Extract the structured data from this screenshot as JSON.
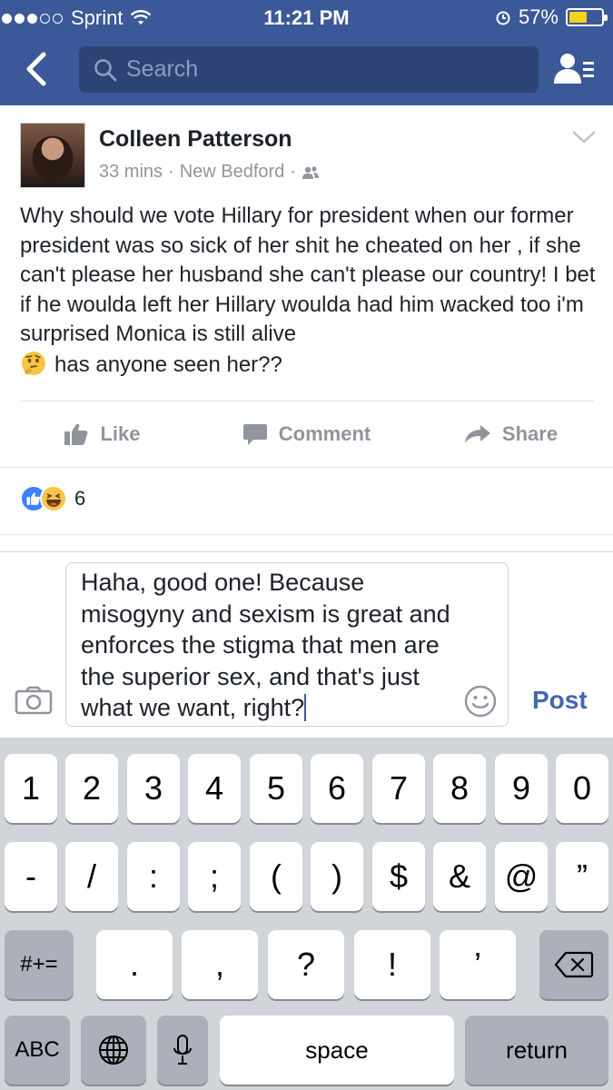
{
  "status_bar": {
    "carrier": "Sprint",
    "time": "11:21 PM",
    "battery": "57%",
    "battery_level": 0.57,
    "accent": "#3b5998"
  },
  "header": {
    "search_placeholder": "Search",
    "back_icon": "chevron-left-icon",
    "friends_icon": "friend-requests-icon"
  },
  "post": {
    "author": "Colleen Patterson",
    "time": "33 mins",
    "location": "New Bedford",
    "separator": "·",
    "audience_icon": "friends-audience-icon",
    "text": "Why should we vote Hillary for president when our former president was so sick of her shit he cheated on her , if she can't please her husband she can't please our country! I bet if he woulda left her Hillary woulda had him wacked too i'm surprised Monica is still alive",
    "text_tail": "has anyone seen her??",
    "emoji": "thinking-face-emoji",
    "actions": [
      {
        "label": "Like",
        "icon": "thumbs-up-icon"
      },
      {
        "label": "Comment",
        "icon": "comment-bubble-icon"
      },
      {
        "label": "Share",
        "icon": "share-arrow-icon"
      }
    ],
    "reaction_count": "6"
  },
  "composer": {
    "text": "Haha, good one! Because misogyny and sexism is great and enforces the stigma that men are the superior sex, and that's just what we want, right?",
    "post_label": "Post"
  },
  "keyboard": {
    "row1": [
      "1",
      "2",
      "3",
      "4",
      "5",
      "6",
      "7",
      "8",
      "9",
      "0"
    ],
    "row2": [
      "-",
      "/",
      ":",
      ";",
      "(",
      ")",
      "$",
      "&",
      "@",
      "”"
    ],
    "row3_left": "#+=",
    "row3": [
      ".",
      ",",
      "?",
      "!",
      "’"
    ],
    "abc": "ABC",
    "space": "space",
    "return": "return"
  }
}
